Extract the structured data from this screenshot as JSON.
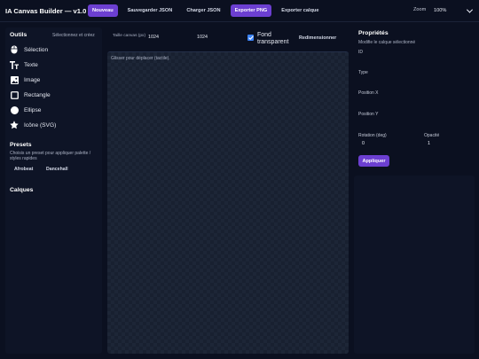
{
  "header": {
    "title": "IA Canvas Builder — v1.0",
    "buttons": [
      {
        "label": "Nouveau",
        "accent": true
      },
      {
        "label": "Sauvegarder JSON",
        "accent": false
      },
      {
        "label": "Charger JSON",
        "accent": false
      },
      {
        "label": "Exporter PNG",
        "accent": true
      },
      {
        "label": "Exporter calque",
        "accent": false
      }
    ],
    "zoom_label": "Zoom",
    "zoom_value": "100%"
  },
  "tools": {
    "title": "Outils",
    "subtitle": "Sélectionnez et créez",
    "items": [
      {
        "label": "Sélection",
        "icon": "mouse-icon"
      },
      {
        "label": "Texte",
        "icon": "text-icon"
      },
      {
        "label": "Image",
        "icon": "image-icon"
      },
      {
        "label": "Rectangle",
        "icon": "square-icon"
      },
      {
        "label": "Ellipse",
        "icon": "circle-icon"
      },
      {
        "label": "Icône (SVG)",
        "icon": "star-icon"
      }
    ]
  },
  "presets": {
    "title": "Presets",
    "subtitle": "Choisis un preset pour appliquer palette / styles rapides",
    "items": [
      "Afrobeat",
      "Dancehall"
    ]
  },
  "layers": {
    "title": "Calques"
  },
  "canvas": {
    "size_label": "Taille canvas (px)",
    "width": "1024",
    "height": "1024",
    "transparent_label": "Fond transparent",
    "transparent_checked": true,
    "resize_label": "Redimensionner",
    "hint": "Glisser pour déplacer (tactile)."
  },
  "properties": {
    "title": "Propriétés",
    "subtitle": "Modifie le calque sélectionné",
    "id_label": "ID",
    "type_label": "Type",
    "pos_x_label": "Position X",
    "pos_y_label": "Position Y",
    "rotation_label": "Rotation (deg)",
    "rotation_value": "0",
    "opacity_label": "Opacité",
    "opacity_value": "1",
    "apply_label": "Appliquer"
  },
  "colors": {
    "background": "#0b1020",
    "panel": "#0e1426",
    "accent": "#6c3fd1",
    "checkbox": "#3b82f6"
  }
}
